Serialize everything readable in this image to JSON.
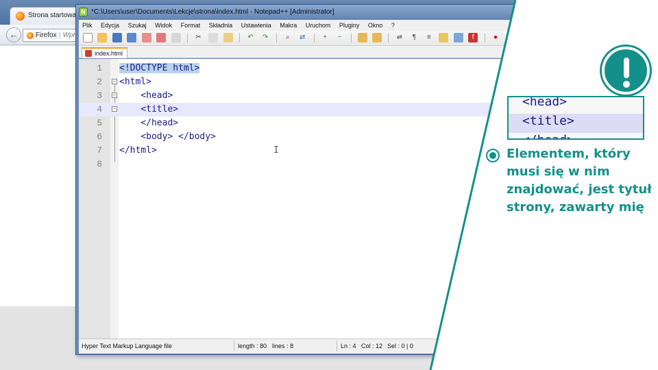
{
  "firefox": {
    "tab_title": "Strona startowa p",
    "brand": "Firefox",
    "url_placeholder": "Wprow"
  },
  "notepad": {
    "window_title": "*C:\\Users\\user\\Documents\\Lekcje\\strona\\index.html - Notepad++ [Administrator]",
    "menu": [
      "Plik",
      "Edycja",
      "Szukaj",
      "Widok",
      "Format",
      "Składnia",
      "Ustawienia",
      "Makra",
      "Uruchom",
      "Pluginy",
      "Okno",
      "?"
    ],
    "file_tab": "index.html",
    "lines": [
      {
        "n": "1",
        "text": "<!DOCTYPE html>",
        "current": false
      },
      {
        "n": "2",
        "text": "<html>",
        "current": false
      },
      {
        "n": "3",
        "text": "    <head>",
        "current": false
      },
      {
        "n": "4",
        "text": "    <title>",
        "current": true
      },
      {
        "n": "5",
        "text": "    </head>",
        "current": false
      },
      {
        "n": "6",
        "text": "    <body> </body>",
        "current": false
      },
      {
        "n": "7",
        "text": "</html>",
        "current": false
      },
      {
        "n": "8",
        "text": "",
        "current": false
      }
    ],
    "status": {
      "file_type": "Hyper Text Markup Language file",
      "length": "length : 80",
      "lines": "lines : 8",
      "ln": "Ln : 4",
      "col": "Col : 12",
      "sel": "Sel : 0 | 0"
    }
  },
  "overlay": {
    "zoom_lines": [
      "<head>",
      "<title>",
      "</head>"
    ],
    "tip_text": "Elementem, który musi się w nim znajdować, jest tytuł strony, zawarty mię",
    "accent_color": "#14908a",
    "badge_icon": "exclamation-icon"
  }
}
